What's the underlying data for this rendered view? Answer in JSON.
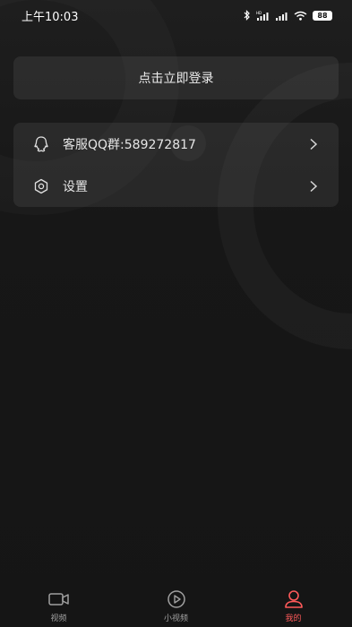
{
  "status_bar": {
    "time": "上午10:03",
    "battery": "88",
    "icons": [
      "bluetooth-icon",
      "signal-hd-icon",
      "signal-icon",
      "wifi-icon",
      "battery-icon"
    ]
  },
  "login": {
    "label": "点击立即登录"
  },
  "menu": {
    "items": [
      {
        "label": "客服QQ群:589272817",
        "icon": "qq-icon"
      },
      {
        "label": "设置",
        "icon": "settings-icon"
      }
    ]
  },
  "nav": {
    "items": [
      {
        "label": "视频",
        "icon": "video-camera-icon",
        "active": false
      },
      {
        "label": "小视频",
        "icon": "play-circle-icon",
        "active": false
      },
      {
        "label": "我的",
        "icon": "user-icon",
        "active": true
      }
    ],
    "active_color": "#ff5a5a",
    "inactive_color": "#a0a0a0"
  }
}
